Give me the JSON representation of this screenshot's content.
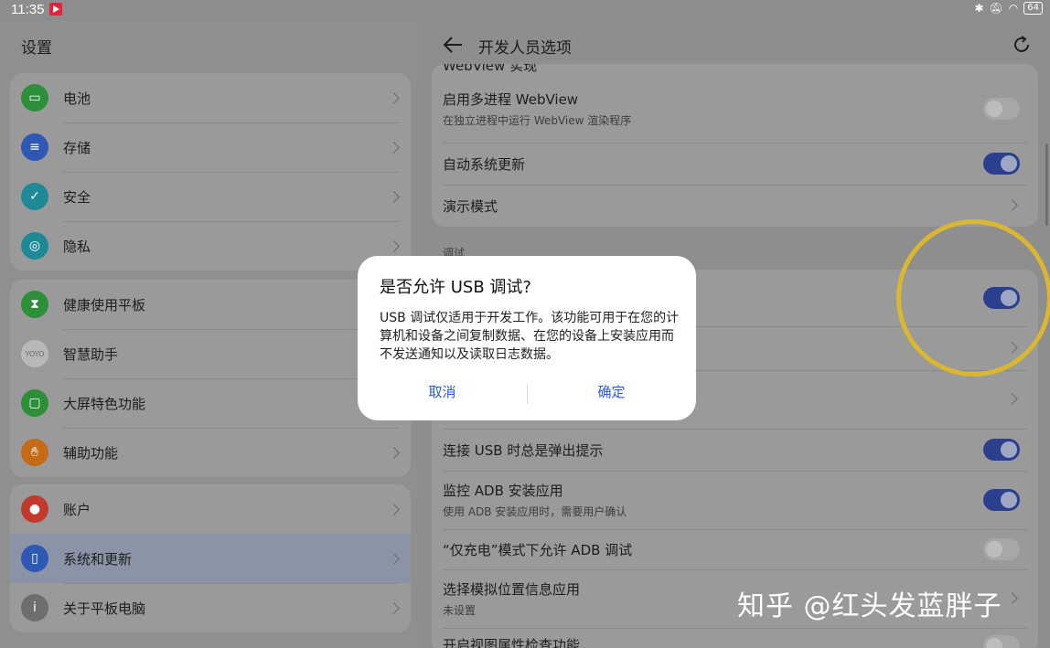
{
  "status_bar": {
    "time": "11:35",
    "battery": "64"
  },
  "left": {
    "title": "设置",
    "group1": [
      {
        "label": "电池",
        "icon": "battery-icon",
        "color": "#2e8f3b"
      },
      {
        "label": "存储",
        "icon": "storage-icon",
        "color": "#2f58b5"
      },
      {
        "label": "安全",
        "icon": "security-shield-icon",
        "color": "#1e8a95"
      },
      {
        "label": "隐私",
        "icon": "privacy-lock-icon",
        "color": "#1e8a95"
      }
    ],
    "group2": [
      {
        "label": "健康使用平板",
        "icon": "hourglass-icon",
        "color": "#2e8f3b"
      },
      {
        "label": "智慧助手",
        "icon": "yoyo-assistant-icon",
        "color": "#b8b8b8"
      },
      {
        "label": "大屏特色功能",
        "icon": "large-screen-icon",
        "color": "#2e8f3b"
      },
      {
        "label": "辅助功能",
        "icon": "hand-icon",
        "color": "#c56a17"
      }
    ],
    "group3": [
      {
        "label": "账户",
        "icon": "account-icon",
        "color": "#c23a2d"
      },
      {
        "label": "系统和更新",
        "icon": "system-update-icon",
        "color": "#2f58b5"
      },
      {
        "label": "关于平板电脑",
        "icon": "info-icon",
        "color": "#6e6e6e"
      }
    ]
  },
  "right": {
    "title": "开发人员选项",
    "partial_top": "WebView 实现",
    "card1": [
      {
        "title": "启用多进程 WebView",
        "subtitle": "在独立进程中运行 WebView 渲染程序",
        "control": "toggle",
        "state": "off"
      },
      {
        "title": "自动系统更新",
        "subtitle": "",
        "control": "toggle",
        "state": "on"
      },
      {
        "title": "演示模式",
        "subtitle": "",
        "control": "chevron",
        "state": ""
      }
    ],
    "section_debug": "调试",
    "card2": [
      {
        "title": "",
        "subtitle": "",
        "control": "toggle",
        "state": "on"
      },
      {
        "title": "",
        "subtitle": "",
        "control": "chevron",
        "state": ""
      },
      {
        "title": "",
        "subtitle": "",
        "control": "chevron",
        "state": ""
      },
      {
        "title": "连接 USB 时总是弹出提示",
        "subtitle": "",
        "control": "toggle",
        "state": "on"
      },
      {
        "title": "监控 ADB 安装应用",
        "subtitle": "使用 ADB 安装应用时，需要用户确认",
        "control": "toggle",
        "state": "on"
      },
      {
        "title": "“仅充电”模式下允许 ADB 调试",
        "subtitle": "",
        "control": "toggle",
        "state": "off"
      },
      {
        "title": "选择模拟位置信息应用",
        "subtitle": "未设置",
        "control": "chevron",
        "state": ""
      },
      {
        "title": "开启视图属性检查功能",
        "subtitle": "",
        "control": "toggle",
        "state": "off"
      }
    ]
  },
  "dialog": {
    "title": "是否允许 USB 调试?",
    "body": "USB 调试仅适用于开发工作。该功能可用于在您的计算机和设备之间复制数据、在您的设备上安装应用而不发送通知以及读取日志数据。",
    "cancel": "取消",
    "confirm": "确定"
  },
  "watermark": "知乎 @红头发蓝胖子",
  "colors": {
    "toggle_on": "#2c3f8c",
    "dialog_button": "#2a5bd7",
    "annotation": "#d9b730"
  }
}
